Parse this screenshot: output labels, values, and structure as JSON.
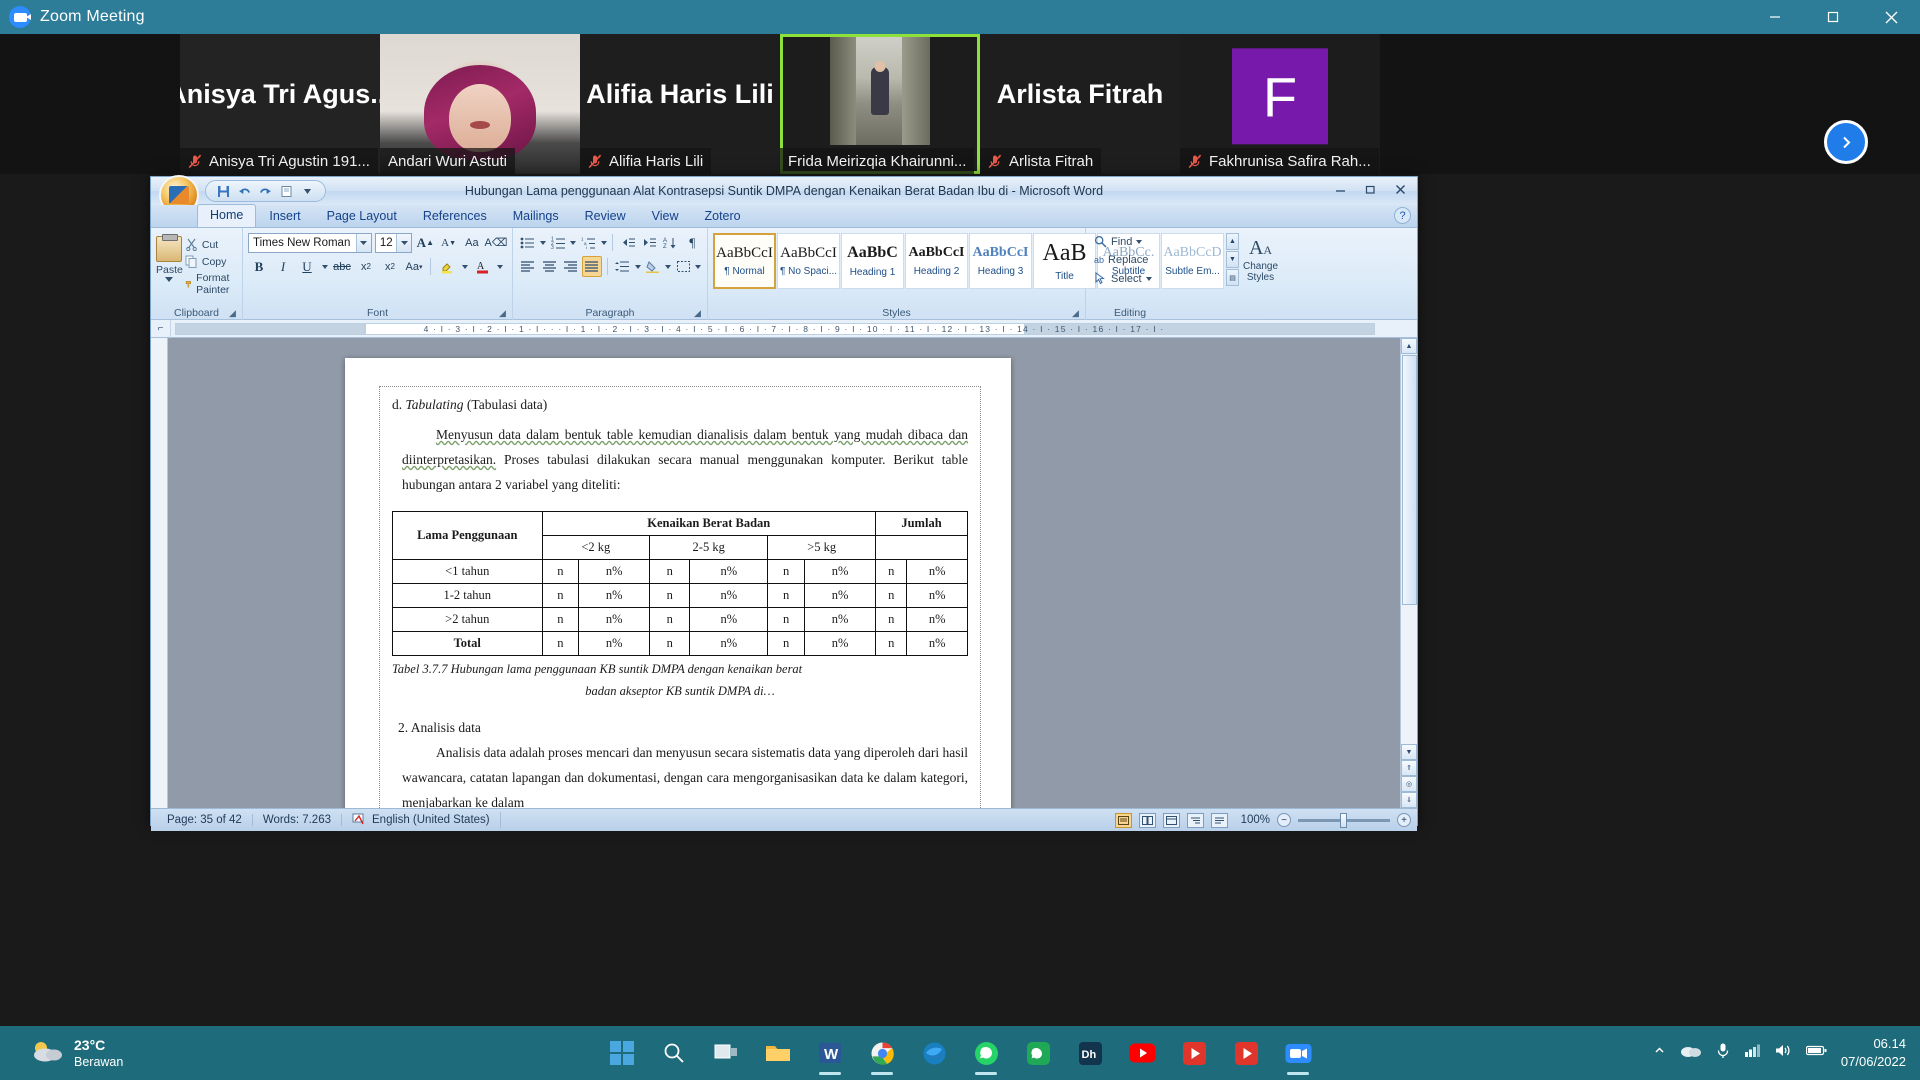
{
  "zoom_window": {
    "title": "Zoom Meeting",
    "window_buttons": [
      "minimize",
      "maximize",
      "close"
    ],
    "next_page_arrow": "next-participants",
    "participants": [
      {
        "name_big": "Anisya  Tri  Agus...",
        "name_label": "Anisya Tri Agustin 191...",
        "muted": true,
        "video": false,
        "active": false,
        "kind": "name"
      },
      {
        "name_big": "",
        "name_label": "Andari Wuri Astuti",
        "muted": false,
        "video": true,
        "active": false,
        "kind": "video-hijab"
      },
      {
        "name_big": "Alifia Haris Lili",
        "name_label": "Alifia Haris Lili",
        "muted": true,
        "video": false,
        "active": false,
        "kind": "name"
      },
      {
        "name_big": "",
        "name_label": "Frida Meirizqia Khairunni...",
        "muted": false,
        "video": true,
        "active": true,
        "kind": "video-street"
      },
      {
        "name_big": "Arlista Fitrah",
        "name_label": "Arlista Fitrah",
        "muted": true,
        "video": false,
        "active": false,
        "kind": "name"
      },
      {
        "name_big": "",
        "name_label": "Fakhrunisa Safira Rah...",
        "muted": true,
        "video": false,
        "active": false,
        "kind": "avatar",
        "avatar_letter": "F",
        "avatar_color": "#7719aa"
      }
    ]
  },
  "word": {
    "title": "Hubungan Lama penggunaan Alat Kontrasepsi Suntik DMPA dengan Kenaikan Berat Badan Ibu di  -  Microsoft Word",
    "quick_access": [
      "save-icon",
      "undo-icon",
      "redo-icon",
      "print-preview-icon",
      "customize-qat-icon"
    ],
    "window_buttons": [
      "minimize",
      "restore",
      "close"
    ],
    "help_button": "?",
    "tabs": [
      {
        "label": "Home",
        "active": true
      },
      {
        "label": "Insert",
        "active": false
      },
      {
        "label": "Page Layout",
        "active": false
      },
      {
        "label": "References",
        "active": false
      },
      {
        "label": "Mailings",
        "active": false
      },
      {
        "label": "Review",
        "active": false
      },
      {
        "label": "View",
        "active": false
      },
      {
        "label": "Zotero",
        "active": false
      }
    ],
    "ribbon": {
      "clipboard": {
        "label": "Clipboard",
        "paste": "Paste",
        "cut": "Cut",
        "copy": "Copy",
        "format_painter": "Format Painter"
      },
      "font": {
        "label": "Font",
        "font_name": "Times New Roman",
        "font_size": "12",
        "buttons": [
          "grow-font",
          "shrink-font",
          "change-case",
          "bold",
          "italic",
          "underline",
          "strikethrough",
          "subscript",
          "superscript",
          "text-effects",
          "highlight",
          "font-color",
          "clear-formatting"
        ]
      },
      "paragraph": {
        "label": "Paragraph",
        "buttons": [
          "bullets",
          "numbering",
          "multilevel-list",
          "decrease-indent",
          "increase-indent",
          "sort",
          "show-marks",
          "align-left",
          "align-center",
          "align-right",
          "justify",
          "line-spacing",
          "shading",
          "borders"
        ]
      },
      "styles": {
        "label": "Styles",
        "gallery": [
          {
            "preview": "AaBbCcI",
            "name": "¶ Normal",
            "selected": true,
            "style": "normal"
          },
          {
            "preview": "AaBbCcI",
            "name": "¶ No Spaci...",
            "selected": false,
            "style": "normal"
          },
          {
            "preview": "AaBbC",
            "name": "Heading 1",
            "selected": false,
            "style": "h1"
          },
          {
            "preview": "AaBbCcI",
            "name": "Heading 2",
            "selected": false,
            "style": "h2"
          },
          {
            "preview": "AaBbCcI",
            "name": "Heading 3",
            "selected": false,
            "style": "h3"
          },
          {
            "preview": "AaB",
            "name": "Title",
            "selected": false,
            "style": "title"
          },
          {
            "preview": "AaBbCc.",
            "name": "Subtitle",
            "selected": false,
            "style": "sub"
          },
          {
            "preview": "AaBbCcD",
            "name": "Subtle Em...",
            "selected": false,
            "style": "subem"
          }
        ],
        "change_styles": "Change Styles"
      },
      "editing": {
        "label": "Editing",
        "find": "Find",
        "replace": "Replace",
        "select": "Select"
      }
    },
    "ruler_ticks": "4 · I · 3 · I · 2 · I · 1 · I · · · I · 1 · I · 2 · I · 3 · I · 4 · I · 5 · I · 6 · I · 7 · I · 8 · I · 9 · I · 10 · I · 11 · I · 12 · I · 13 · I · 14 ·  I · 15 · I · 16 · I · 17 · I ·",
    "document": {
      "list_item_letter": "d.",
      "list_item_italic": "Tabulating",
      "list_item_rest": "(Tabulasi  data)",
      "paragraph_1a": "Menyusun  data  dalam  bentuk  table  kemudian  dianalisis  dalam  bentuk yang  mudah  dibaca  dan  diinterpretasikan.",
      "paragraph_1b": " Proses  tabulasi  dilakukan  secara manual  menggunakan  komputer.  Berikut  table  hubungan  antara  2  variabel yang diteliti:",
      "table": {
        "header_col1": "Lama Penggunaan",
        "header_group": "Kenaikan Berat Badan",
        "header_total": "Jumlah",
        "subheaders": [
          "<2 kg",
          "2-5 kg",
          ">5 kg"
        ],
        "rows": [
          {
            "label": "<1 tahun",
            "cells": [
              "n",
              "n%",
              "n",
              "n%",
              "n",
              "n%",
              "n",
              "n%"
            ],
            "bold": false
          },
          {
            "label": "1-2 tahun",
            "cells": [
              "n",
              "n%",
              "n",
              "n%",
              "n",
              "n%",
              "n",
              "n%"
            ],
            "bold": false
          },
          {
            "label": ">2 tahun",
            "cells": [
              "n",
              "n%",
              "n",
              "n%",
              "n",
              "n%",
              "n",
              "n%"
            ],
            "bold": false
          },
          {
            "label": "Total",
            "cells": [
              "n",
              "n%",
              "n",
              "n%",
              "n",
              "n%",
              "n",
              "n%"
            ],
            "bold": true
          }
        ]
      },
      "caption_line1": "Tabel 3.7.7  Hubungan lama penggunaan KB suntik DMPA dengan kenaikan berat",
      "caption_line2": "badan akseptor KB suntik DMPA di…",
      "list2_number": "2.",
      "list2_label": "Analisis data",
      "paragraph_2": "Analisis data adalah proses mencari dan menyusun secara sistematis data yang  diperoleh  dari  hasil  wawancara,  catatan  lapangan  dan  dokumentasi, dengan  cara  mengorganisasikan  data  ke  dalam  kategori,  menjabarkan  ke  dalam"
    },
    "status_bar": {
      "page": "Page: 35 of 42",
      "words": "Words: 7.263",
      "proofing_icon": "spell-check-icon",
      "language": "English (United States)",
      "view_buttons": [
        "print-layout",
        "full-screen-reading",
        "web-layout",
        "outline",
        "draft"
      ],
      "zoom_level": "100%",
      "zoom_out": "−",
      "zoom_in": "+"
    }
  },
  "taskbar": {
    "weather_temp": "23°C",
    "weather_desc": "Berawan",
    "weather_icon": "cloud-icon",
    "items": [
      {
        "name": "start-button",
        "icon": "windows-logo",
        "running": false
      },
      {
        "name": "search-button",
        "icon": "search-icon",
        "running": false
      },
      {
        "name": "task-view-button",
        "icon": "task-view-icon",
        "running": false
      },
      {
        "name": "file-explorer",
        "icon": "folder-icon",
        "running": false
      },
      {
        "name": "microsoft-word",
        "icon": "word-icon",
        "running": true
      },
      {
        "name": "google-chrome",
        "icon": "chrome-icon",
        "running": true
      },
      {
        "name": "mozilla-thunderbird",
        "icon": "bird-icon",
        "running": false
      },
      {
        "name": "whatsapp",
        "icon": "whatsapp-icon",
        "running": true
      },
      {
        "name": "wa-business",
        "icon": "wa-business-icon",
        "running": false
      },
      {
        "name": "dh-app",
        "icon": "dh-icon",
        "running": false
      },
      {
        "name": "youtube",
        "icon": "youtube-icon",
        "running": false
      },
      {
        "name": "media-player-1",
        "icon": "play-icon",
        "running": false
      },
      {
        "name": "media-player-2",
        "icon": "play-icon",
        "running": false
      },
      {
        "name": "zoom-app",
        "icon": "zoom-camera-icon",
        "running": true
      }
    ],
    "tray": [
      "chevron-up-icon",
      "onedrive-icon",
      "microphone-icon",
      "network-icon",
      "volume-icon",
      "battery-icon"
    ],
    "clock_time": "06.14",
    "clock_date": "07/06/2022"
  }
}
